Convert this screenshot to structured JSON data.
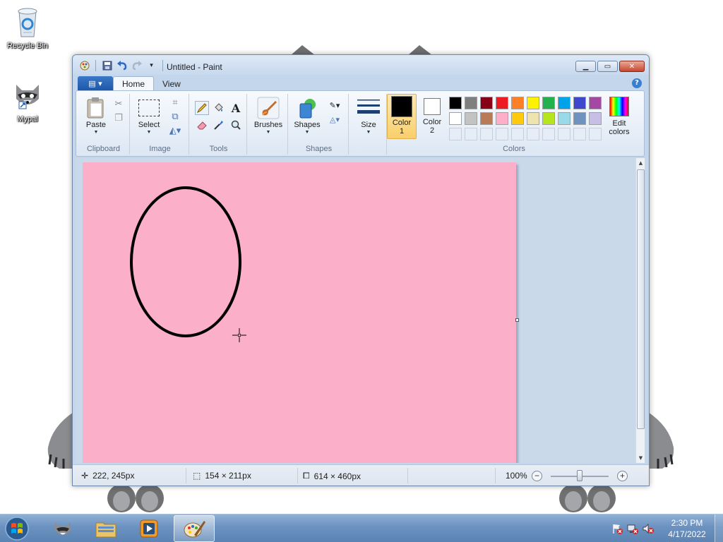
{
  "desktop": {
    "icons": [
      {
        "label": "Recycle Bin",
        "icon": "recycle-bin-icon"
      },
      {
        "label": "Mypal",
        "icon": "mypal-raccoon-icon"
      }
    ]
  },
  "window": {
    "title": "Untitled - Paint",
    "quick_access": [
      "app-menu-icon",
      "save-icon",
      "undo-icon",
      "redo-icon",
      "customize-qat-icon"
    ]
  },
  "ribbon": {
    "tabs": [
      {
        "label": "Home",
        "active": true
      },
      {
        "label": "View",
        "active": false
      }
    ],
    "groups": {
      "clipboard": {
        "label": "Clipboard",
        "paste": "Paste"
      },
      "image": {
        "label": "Image",
        "select": "Select"
      },
      "tools": {
        "label": "Tools"
      },
      "brushes": {
        "label": "Brushes"
      },
      "shapes": {
        "label": "Shapes",
        "shapes_btn": "Shapes"
      },
      "size": {
        "label": "Size"
      },
      "colors": {
        "label": "Colors",
        "color1_label": "Color",
        "color1_num": "1",
        "color2_label": "Color",
        "color2_num": "2",
        "edit_label": "Edit",
        "edit_label2": "colors",
        "color1": "#000000",
        "color2": "#ffffff",
        "palette_row1": [
          "#000000",
          "#7f7f7f",
          "#880015",
          "#ed1c24",
          "#ff7f27",
          "#fff200",
          "#22b14c",
          "#00a2e8",
          "#3f48cc",
          "#a349a4"
        ],
        "palette_row2": [
          "#ffffff",
          "#c3c3c3",
          "#b97a57",
          "#ffaec9",
          "#ffc90e",
          "#efe4b0",
          "#b5e61d",
          "#99d9ea",
          "#7092be",
          "#c8bfe7"
        ]
      }
    }
  },
  "canvas": {
    "background": "#fbafc9",
    "stroke_color": "#000000"
  },
  "statusbar": {
    "cursor_pos": "222, 245px",
    "selection_size": "154 × 211px",
    "image_size": "614 × 460px",
    "zoom": "100%"
  },
  "taskbar": {
    "time": "2:30 PM",
    "date": "4/17/2022"
  }
}
